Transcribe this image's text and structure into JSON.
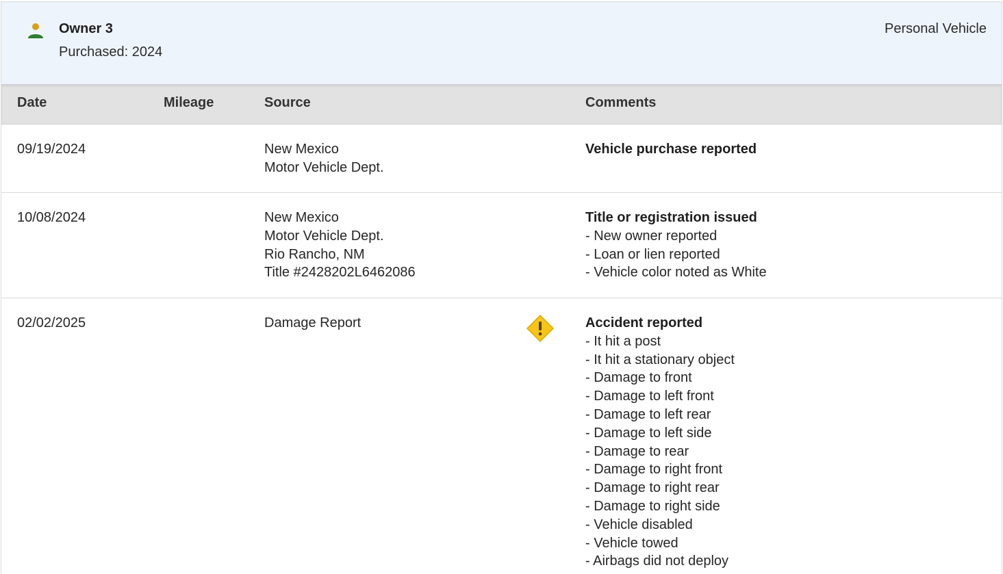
{
  "owner": {
    "title": "Owner 3",
    "purchased": "Purchased: 2024",
    "type": "Personal Vehicle",
    "icon": "person-icon",
    "icon_color": "#2e7d32",
    "icon_head_color": "#d4a017"
  },
  "columns": {
    "date": "Date",
    "mileage": "Mileage",
    "source": "Source",
    "comments": "Comments"
  },
  "rows": [
    {
      "date": "09/19/2024",
      "mileage": "",
      "source": [
        "New Mexico",
        "Motor Vehicle Dept."
      ],
      "comment_title": "Vehicle purchase reported",
      "comment_items": []
    },
    {
      "date": "10/08/2024",
      "mileage": "",
      "source": [
        "New Mexico",
        "Motor Vehicle Dept.",
        "Rio Rancho, NM",
        "Title #2428202L6462086"
      ],
      "comment_title": "Title or registration issued",
      "comment_items": [
        "- New owner reported",
        "- Loan or lien reported",
        "- Vehicle color noted as White"
      ]
    },
    {
      "date": "02/02/2025",
      "mileage": "",
      "source": [
        "Damage Report"
      ],
      "icon": "warning-icon",
      "icon_color": "#f5c518",
      "comment_title": "Accident reported",
      "comment_items": [
        "- It hit a post",
        "- It hit a stationary object",
        "- Damage to front",
        "- Damage to left front",
        "- Damage to left rear",
        "- Damage to left side",
        "- Damage to rear",
        "- Damage to right front",
        "- Damage to right rear",
        "- Damage to right side",
        "- Vehicle disabled",
        "- Vehicle towed",
        "- Airbags did not deploy"
      ]
    }
  ]
}
